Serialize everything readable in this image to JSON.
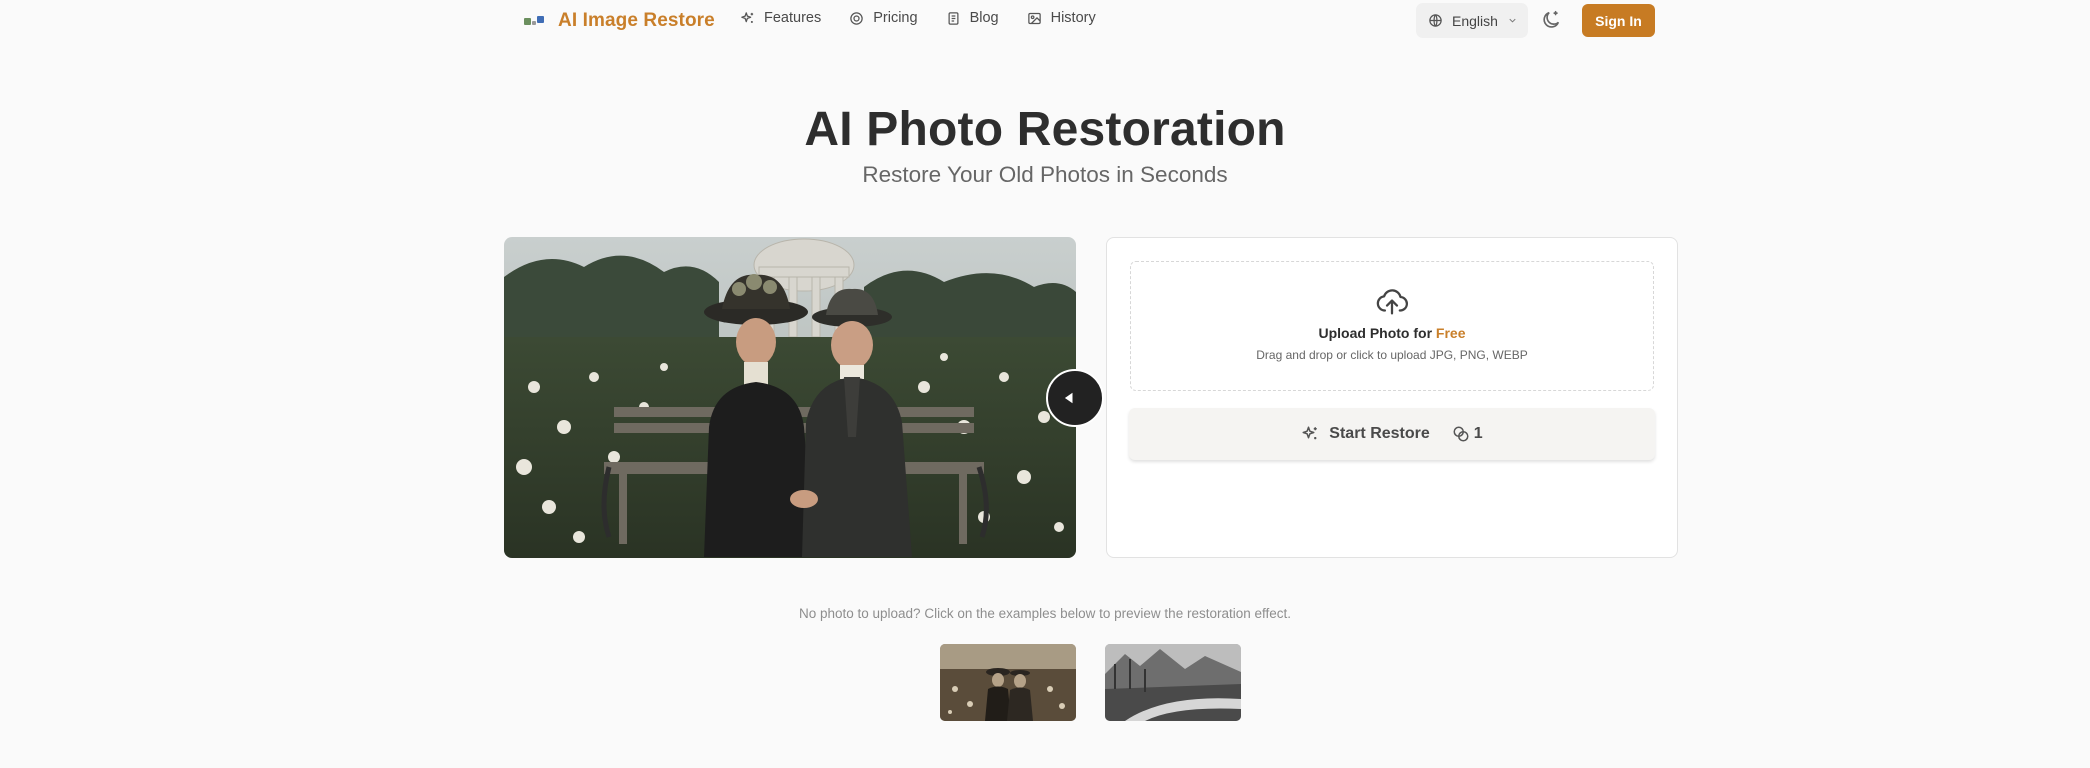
{
  "brand": {
    "name": "AI Image Restore"
  },
  "nav": {
    "features": "Features",
    "pricing": "Pricing",
    "blog": "Blog",
    "history": "History"
  },
  "language": {
    "selected": "English"
  },
  "signin_label": "Sign In",
  "hero": {
    "title": "AI Photo Restoration",
    "subtitle": "Restore Your Old Photos in Seconds"
  },
  "upload": {
    "title_prefix": "Upload Photo for ",
    "title_highlight": "Free",
    "hint": "Drag and drop or click to upload JPG, PNG, WEBP"
  },
  "start": {
    "label": "Start Restore",
    "credits": "1"
  },
  "examples": {
    "hint": "No photo to upload? Click on the examples below to preview the restoration effect."
  },
  "colors": {
    "accent": "#c77b23",
    "brand_text": "#c97f2a",
    "background": "#fafafa"
  },
  "icons": {
    "features": "sparkles-icon",
    "pricing": "coin-icon",
    "blog": "document-icon",
    "history": "image-icon",
    "language": "globe-icon",
    "theme": "moon-icon",
    "upload": "cloud-upload-icon",
    "start": "sparkles-icon",
    "credits": "coins-icon"
  }
}
